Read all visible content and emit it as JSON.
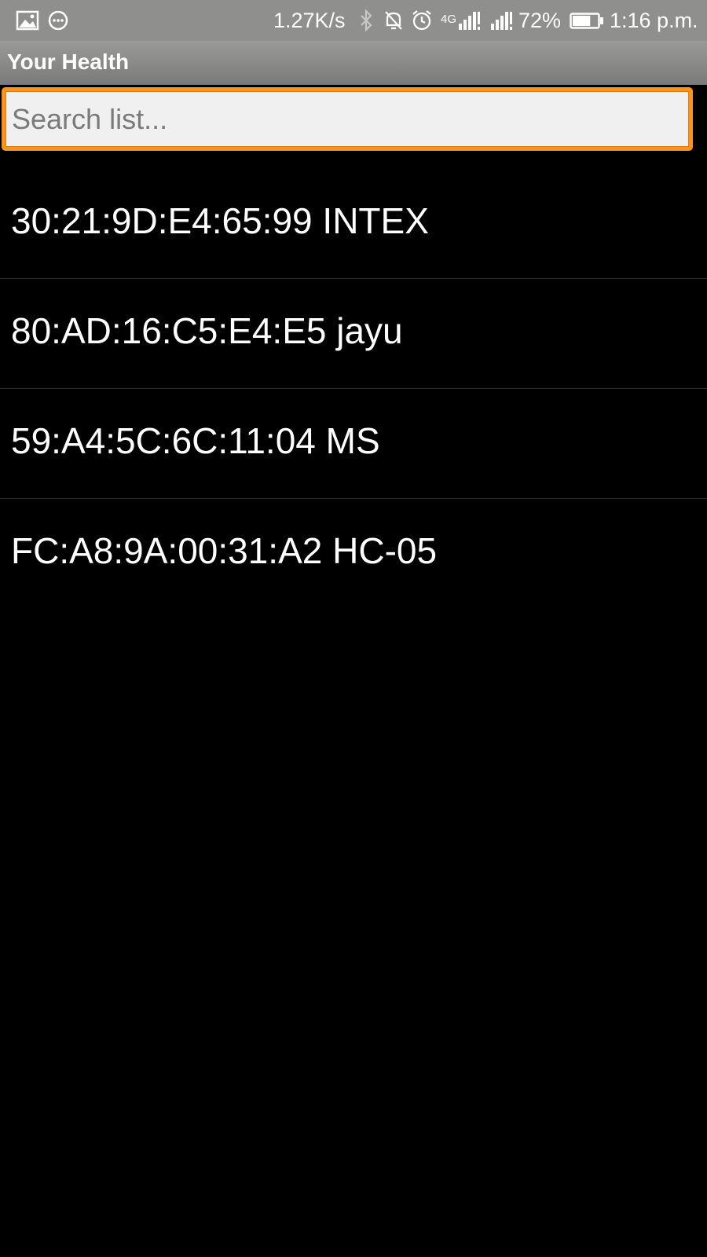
{
  "status_bar": {
    "left_icons": [
      "image-icon",
      "chat-bubble-icon"
    ],
    "net_speed": "1.27K/s",
    "right_icons": [
      "bluetooth-icon",
      "mute-icon",
      "alarm-icon",
      "signal-4g-icon",
      "signal-icon",
      "battery-icon"
    ],
    "network_label": "4G",
    "battery_percent": "72%",
    "battery_level": 0.72,
    "time": "1:16 p.m."
  },
  "app_bar": {
    "title": "Your Health"
  },
  "search": {
    "placeholder": "Search list...",
    "value": "",
    "accent_color": "#f7941d"
  },
  "devices": [
    {
      "label": "30:21:9D:E4:65:99 INTEX"
    },
    {
      "label": "80:AD:16:C5:E4:E5 jayu"
    },
    {
      "label": "59:A4:5C:6C:11:04 MS"
    },
    {
      "label": "FC:A8:9A:00:31:A2 HC-05"
    }
  ]
}
